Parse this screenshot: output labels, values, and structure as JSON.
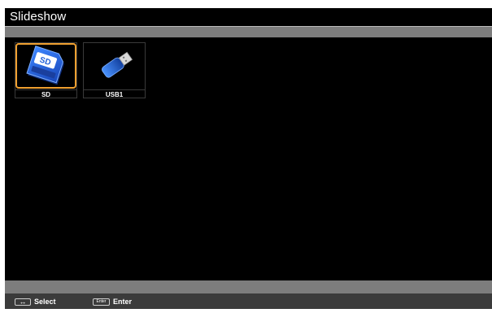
{
  "window": {
    "title": "Slideshow"
  },
  "sources": [
    {
      "label": "SD",
      "icon": "sd-card-icon",
      "selected": true
    },
    {
      "label": "USB1",
      "icon": "usb-drive-icon",
      "selected": false
    }
  ],
  "hints": {
    "select_key": "↔",
    "select_label": "Select",
    "enter_key": "Enter",
    "enter_label": "Enter"
  },
  "colors": {
    "selection": "#f0a030",
    "screen": "#000000",
    "bar": "#7d7d7d",
    "hint_bar": "#3b3b3b",
    "device_blue": "#1e5fd8"
  }
}
